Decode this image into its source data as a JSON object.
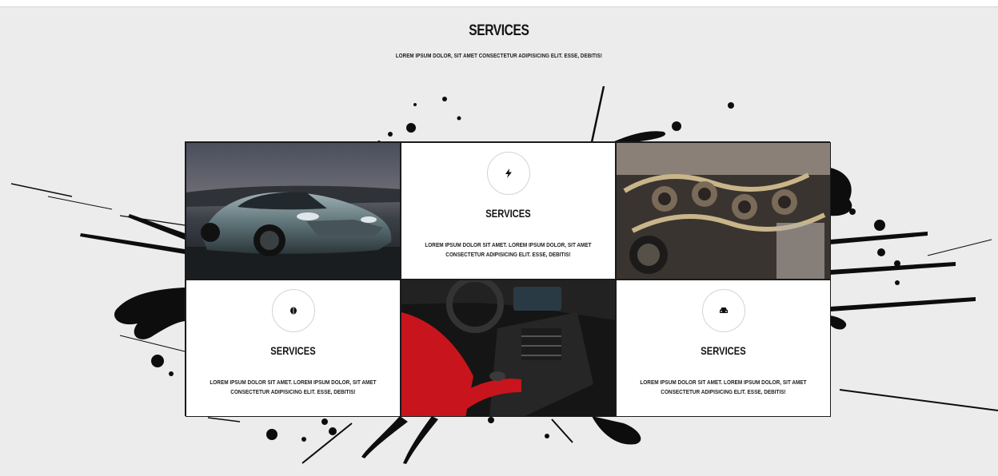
{
  "section": {
    "title": "SERVICES",
    "subtitle": "LOREM IPSUM DOLOR, SIT AMET CONSECTETUR ADIPISICING ELIT. ESSE, DEBITIS!"
  },
  "cards": [
    {
      "icon": "lightning-bolt-icon",
      "title": "SERVICES",
      "text": "LOREM IPSUM DOLOR SIT AMET. LOREM IPSUM DOLOR, SIT AMET CONSECTETUR ADIPISICING ELIT. ESSE, DEBITIS!"
    },
    {
      "icon": "brain-icon",
      "title": "SERVICES",
      "text": "LOREM IPSUM DOLOR SIT AMET. LOREM IPSUM DOLOR, SIT AMET CONSECTETUR ADIPISICING ELIT. ESSE, DEBITIS!"
    },
    {
      "icon": "car-icon",
      "title": "SERVICES",
      "text": "LOREM IPSUM DOLOR SIT AMET. LOREM IPSUM DOLOR, SIT AMET CONSECTETUR ADIPISICING ELIT. ESSE, DEBITIS!"
    }
  ],
  "photos": [
    {
      "subject": "sports-car-photo"
    },
    {
      "subject": "engine-photo"
    },
    {
      "subject": "car-interior-photo"
    }
  ],
  "colors": {
    "background": "#ececec",
    "ink": "#111111",
    "card": "#ffffff",
    "interior_red": "#c8141c"
  }
}
